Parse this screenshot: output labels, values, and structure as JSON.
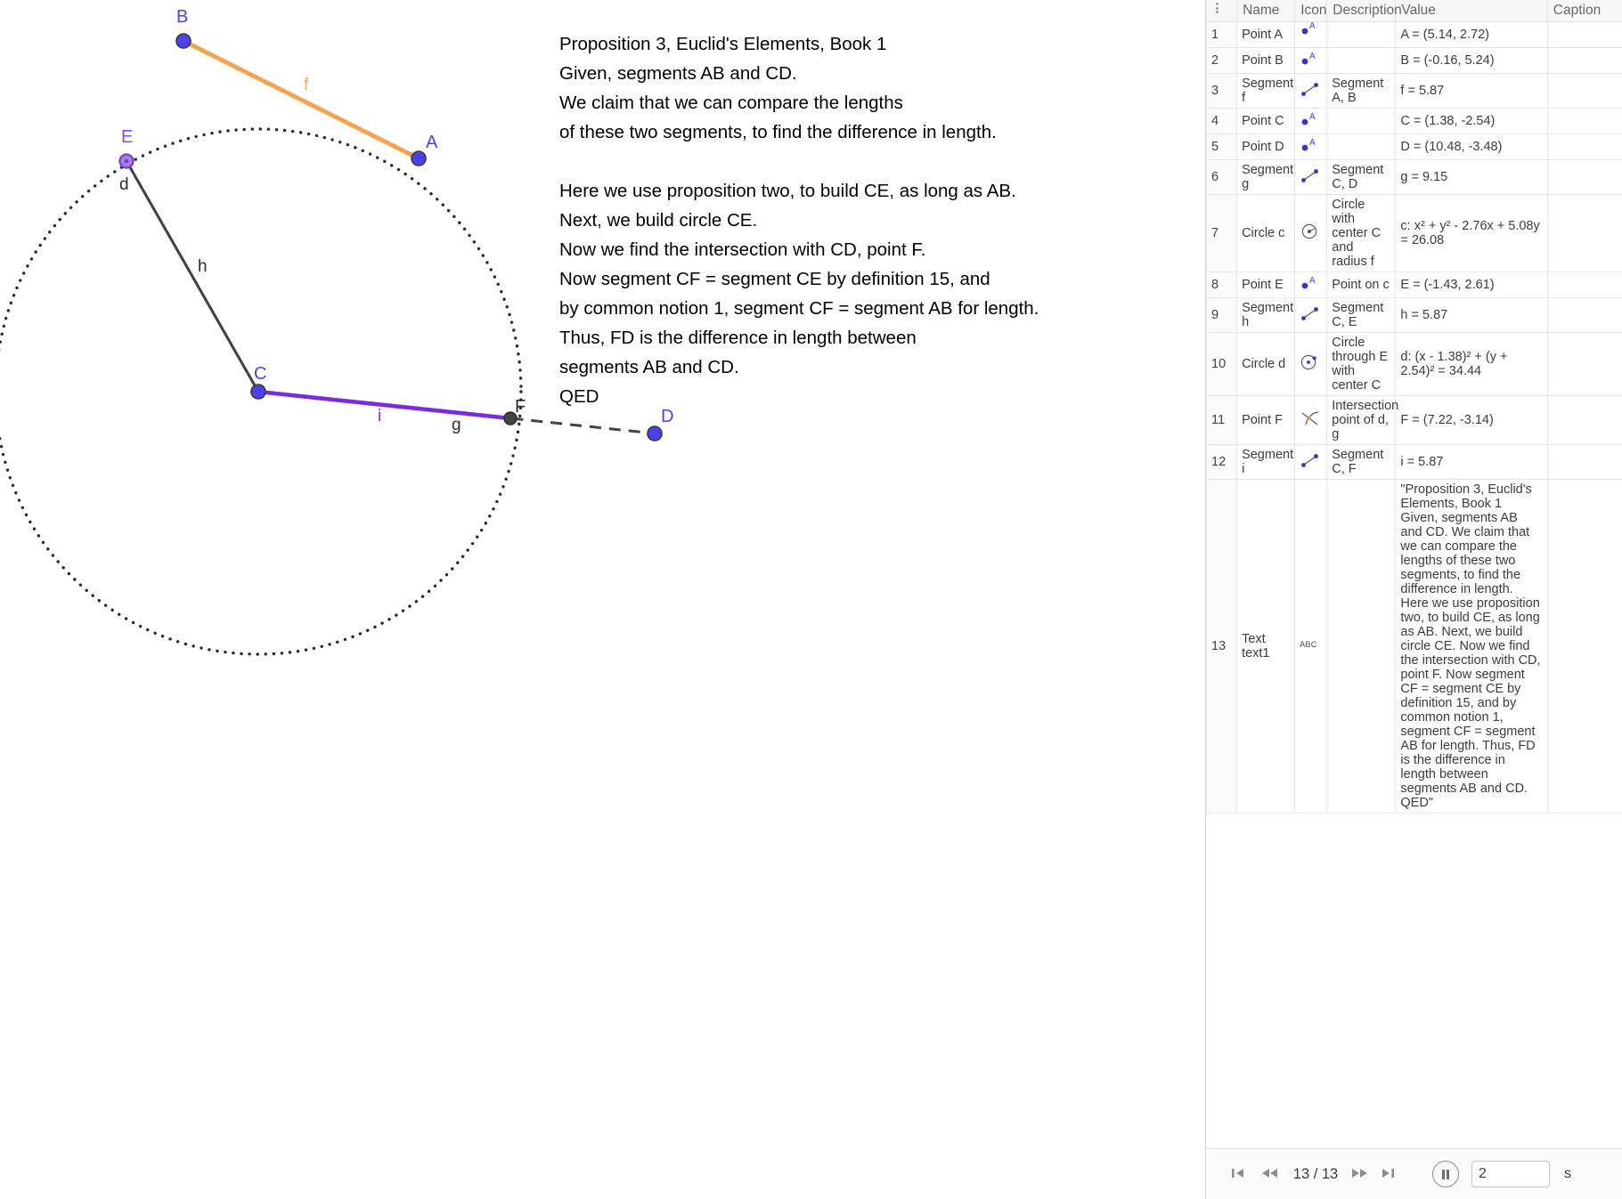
{
  "colors": {
    "point_blue": "#3B33C9",
    "point_blue_fill": "#4A41E8",
    "segment_orange": "#F5A44E",
    "segment_purple": "#7A2BE0",
    "segment_gray": "#434343",
    "label_violet": "#8B4BEE",
    "label_blue": "#4A41E8",
    "label_dark": "#2b2b2b",
    "header_bg": "#f7f7f7",
    "grid_line": "#e6e6e6"
  },
  "graphics": {
    "proof_text": "Proposition 3, Euclid's Elements, Book 1\nGiven, segments AB and CD.\nWe claim that we can compare the lengths\nof these two segments, to find the difference in length.\n\nHere we use proposition two, to build CE, as long as AB.\nNext, we build circle CE.\nNow we find the intersection with CD, point F.\nNow segment CF = segment CE by definition 15, and\nby common notion 1, segment CF = segment AB for length.\nThus, FD is the difference in length between\nsegments AB and CD.\nQED",
    "labels": {
      "A": "A",
      "B": "B",
      "C": "C",
      "D": "D",
      "E": "E",
      "F": "F",
      "f": "f",
      "g": "g",
      "h": "h",
      "i": "i",
      "d": "d"
    }
  },
  "table": {
    "headers": [
      "",
      "Name",
      "Icon",
      "Description",
      "Value",
      "Caption"
    ],
    "rows": [
      {
        "n": "1",
        "name": "Point A",
        "icon": "point-icon",
        "desc": "",
        "value": "A = (5.14, 2.72)",
        "caption": ""
      },
      {
        "n": "2",
        "name": "Point B",
        "icon": "point-icon",
        "desc": "",
        "value": "B = (-0.16, 5.24)",
        "caption": ""
      },
      {
        "n": "3",
        "name": "Segment f",
        "icon": "segment-icon",
        "desc": "Segment A, B",
        "value": "f = 5.87",
        "caption": ""
      },
      {
        "n": "4",
        "name": "Point C",
        "icon": "point-icon",
        "desc": "",
        "value": "C = (1.38, -2.54)",
        "caption": ""
      },
      {
        "n": "5",
        "name": "Point D",
        "icon": "point-icon",
        "desc": "",
        "value": "D = (10.48, -3.48)",
        "caption": ""
      },
      {
        "n": "6",
        "name": "Segment g",
        "icon": "segment-icon",
        "desc": "Segment C, D",
        "value": "g = 9.15",
        "caption": ""
      },
      {
        "n": "7",
        "name": "Circle c",
        "icon": "circle-icon",
        "desc": "Circle with center C and radius f",
        "value": "c: x² + y² - 2.76x + 5.08y = 26.08",
        "caption": ""
      },
      {
        "n": "8",
        "name": "Point E",
        "icon": "point-icon",
        "desc": "Point on c",
        "value": "E = (-1.43, 2.61)",
        "caption": ""
      },
      {
        "n": "9",
        "name": "Segment h",
        "icon": "segment-icon",
        "desc": "Segment C, E",
        "value": "h = 5.87",
        "caption": ""
      },
      {
        "n": "10",
        "name": "Circle d",
        "icon": "circle-through-icon",
        "desc": "Circle through E with center C",
        "value": "d: (x - 1.38)² + (y + 2.54)² = 34.44",
        "caption": ""
      },
      {
        "n": "11",
        "name": "Point F",
        "icon": "intersect-icon",
        "desc": "Intersection point of d, g",
        "value": "F = (7.22, -3.14)",
        "caption": ""
      },
      {
        "n": "12",
        "name": "Segment i",
        "icon": "segment-icon",
        "desc": "Segment C, F",
        "value": "i = 5.87",
        "caption": ""
      },
      {
        "n": "13",
        "name": "Text text1",
        "icon": "abc-icon",
        "desc": "",
        "value": "\"Proposition 3, Euclid's Elements, Book 1 Given, segments AB and CD. We claim that we can compare the lengths of these two segments, to find the difference in length. Here we use proposition two, to build CE, as long as AB. Next, we build circle CE. Now we find the intersection with CD, point F. Now segment CF = segment CE by definition 15, and by common notion 1, segment CF = segment AB for length. Thus, FD is the difference in length between segments AB and CD. QED\"",
        "caption": ""
      }
    ]
  },
  "playback": {
    "first_label": "skip-to-first",
    "prev_label": "step-back",
    "counter": "13 / 13",
    "next_label": "step-forward",
    "last_label": "skip-to-last",
    "pause_label": "pause",
    "speed_value": "2",
    "speed_unit": "s"
  }
}
